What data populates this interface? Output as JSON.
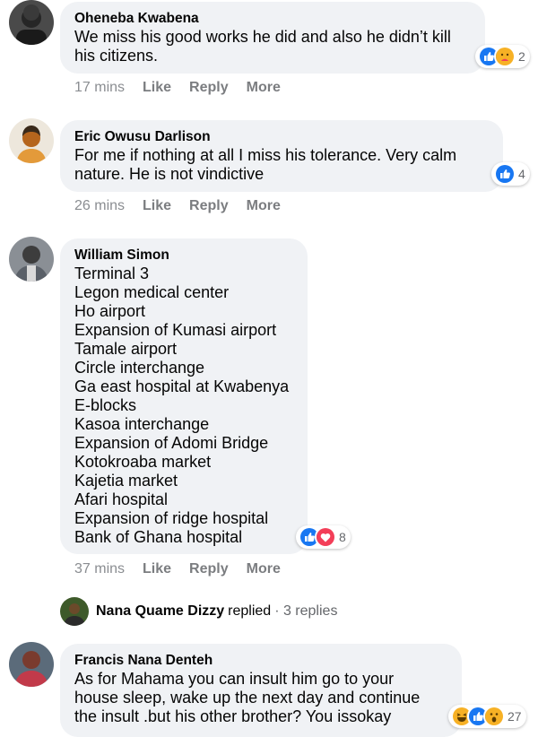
{
  "comments": [
    {
      "author": "Oheneba Kwabena",
      "lines": [
        "We miss his good works he did and also he didn’t kill",
        "his citizens."
      ],
      "time": "17 mins",
      "reaction_count": "2",
      "reactions": [
        "like-icon",
        "care-icon"
      ]
    },
    {
      "author": "Eric Owusu Darlison",
      "lines": [
        "For me if nothing at all I miss his tolerance. Very calm",
        "nature. He is not vindictive"
      ],
      "time": "26 mins",
      "reaction_count": "4",
      "reactions": [
        "like-icon"
      ]
    },
    {
      "author": "William Simon",
      "lines": [
        "Terminal 3",
        "Legon medical center",
        "Ho airport",
        "Expansion of Kumasi airport",
        "Tamale airport",
        "Circle interchange",
        "Ga east hospital at Kwabenya",
        "E-blocks",
        "Kasoa interchange",
        "Expansion of Adomi Bridge",
        "Kotokroaba market",
        "Kajetia market",
        "Afari hospital",
        "Expansion of ridge hospital",
        "Bank of Ghana hospital"
      ],
      "time": "37 mins",
      "reaction_count": "8",
      "reactions": [
        "like-icon",
        "love-icon"
      ]
    },
    {
      "author": "Francis Nana Denteh",
      "lines": [
        "As for Mahama you can insult him go to your",
        "house sleep, wake up the next day and continue",
        "the insult .but his other brother? You issokay"
      ],
      "reaction_count": "27",
      "reactions": [
        "haha-icon",
        "like-icon",
        "wow-icon"
      ]
    }
  ],
  "actions": {
    "like": "Like",
    "reply": "Reply",
    "more": "More"
  },
  "replies_row": {
    "name": "Nana Quame Dizzy",
    "verb": "replied",
    "count": "· 3 replies"
  },
  "colors": {
    "bubble": "#f0f2f5",
    "like_blue": "#1877f2",
    "love_red": "#f33e58",
    "emoji_yellow": "#f7b125",
    "meta_gray": "#65676b"
  }
}
